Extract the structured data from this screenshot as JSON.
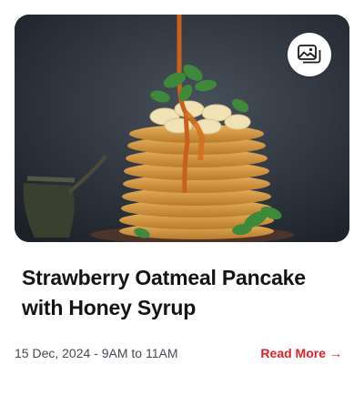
{
  "card": {
    "title": "Strawberry Oatmeal Pancake with Honey Syrup",
    "date_time": "15 Dec, 2024 - 9AM to 11AM",
    "read_more_label": "Read More",
    "read_more_arrow": "→",
    "gallery_icon": "image-gallery-icon",
    "image_subject": "pancake-stack-with-honey-and-banana",
    "colors": {
      "accent": "#e0202a",
      "title": "#141414",
      "meta": "#444a52",
      "background": "#ffffff"
    }
  }
}
